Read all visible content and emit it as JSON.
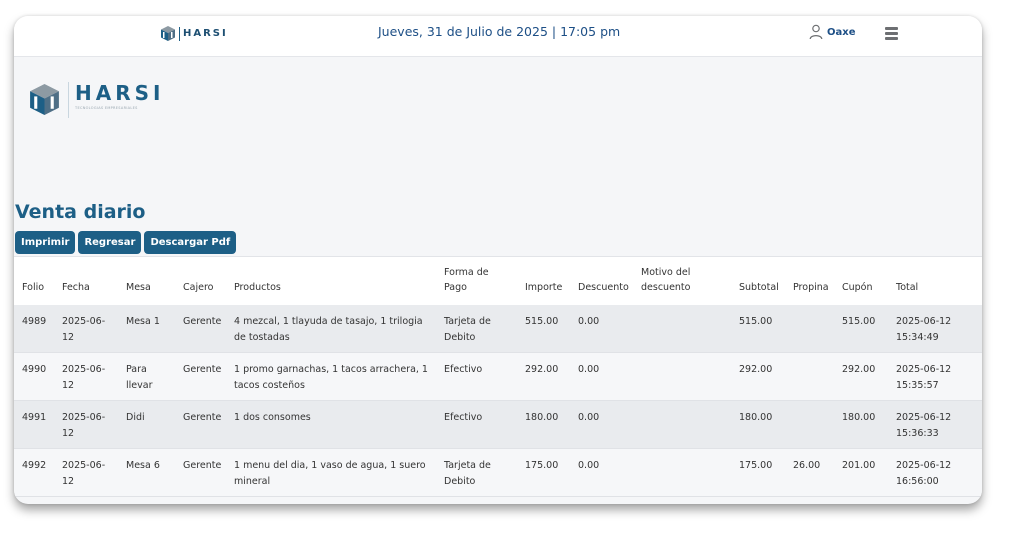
{
  "header": {
    "brand": "HARSI",
    "datetime": "Jueves, 31 de Julio de 2025 | 17:05 pm",
    "user": "Oaxe",
    "icons": {
      "user": "user-icon",
      "menu": "hamburger-menu-icon",
      "logo": "harsi-logo-icon"
    }
  },
  "logo": {
    "brand": "HARSI",
    "tagline": "TECNOLOGIAS EMPRESARIALES"
  },
  "page": {
    "title": "Venta diario"
  },
  "actions": {
    "print": "Imprimir",
    "back": "Regresar",
    "pdf": "Descargar Pdf"
  },
  "table": {
    "headers": {
      "folio": "Folio",
      "fecha": "Fecha",
      "mesa": "Mesa",
      "cajero": "Cajero",
      "productos": "Productos",
      "forma_pago": "Forma de Pago",
      "importe": "Importe",
      "descuento": "Descuento",
      "motivo": "Motivo del descuento",
      "subtotal": "Subtotal",
      "propina": "Propina",
      "cupon": "Cupón",
      "total": "Total"
    },
    "rows": [
      {
        "folio": "4989",
        "fecha": "2025-06-12",
        "mesa": "Mesa 1",
        "cajero": "Gerente",
        "productos": "4 mezcal, 1 tlayuda de tasajo, 1 trilogia de tostadas",
        "forma_pago": "Tarjeta de Debito",
        "importe": "515.00",
        "descuento": "0.00",
        "motivo": "",
        "subtotal": "515.00",
        "propina": "",
        "cupon": "515.00",
        "total": "2025-06-12 15:34:49"
      },
      {
        "folio": "4990",
        "fecha": "2025-06-12",
        "mesa": "Para llevar",
        "cajero": "Gerente",
        "productos": "1 promo garnachas, 1 tacos arrachera, 1 tacos costeños",
        "forma_pago": "Efectivo",
        "importe": "292.00",
        "descuento": "0.00",
        "motivo": "",
        "subtotal": "292.00",
        "propina": "",
        "cupon": "292.00",
        "total": "2025-06-12 15:35:57"
      },
      {
        "folio": "4991",
        "fecha": "2025-06-12",
        "mesa": "Didi",
        "cajero": "Gerente",
        "productos": "1 dos consomes",
        "forma_pago": "Efectivo",
        "importe": "180.00",
        "descuento": "0.00",
        "motivo": "",
        "subtotal": "180.00",
        "propina": "",
        "cupon": "180.00",
        "total": "2025-06-12 15:36:33"
      },
      {
        "folio": "4992",
        "fecha": "2025-06-12",
        "mesa": "Mesa 6",
        "cajero": "Gerente",
        "productos": "1 menu del dia, 1 vaso de agua, 1 suero mineral",
        "forma_pago": "Tarjeta de Debito",
        "importe": "175.00",
        "descuento": "0.00",
        "motivo": "",
        "subtotal": "175.00",
        "propina": "26.00",
        "cupon": "201.00",
        "total": "2025-06-12 16:56:00"
      }
    ]
  },
  "colors": {
    "brand": "#1d5f86",
    "row_odd": "#e9ebee",
    "row_even": "#f6f7f9"
  }
}
